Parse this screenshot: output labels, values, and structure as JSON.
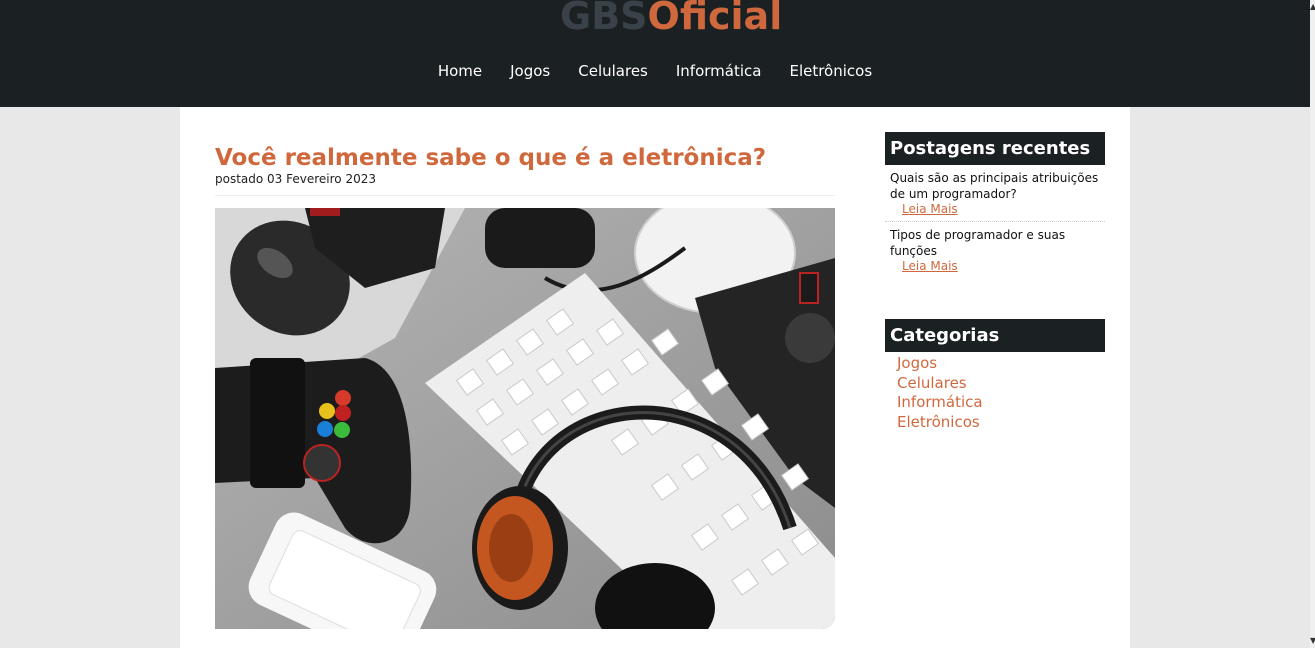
{
  "header": {
    "logo_part1": "GBS",
    "logo_part2": "Oficial",
    "nav": [
      "Home",
      "Jogos",
      "Celulares",
      "Informática",
      "Eletrônicos"
    ]
  },
  "post": {
    "title": "Você realmente sabe o que é a eletrônica?",
    "date": "postado 03 Fevereiro 2023"
  },
  "sidebar": {
    "recent_title": "Postagens recentes",
    "recent": [
      {
        "title": "Quais são as principais atribuições de um programador?",
        "more": "Leia Mais"
      },
      {
        "title": "Tipos de programador e suas funções",
        "more": "Leia Mais"
      }
    ],
    "categories_title": "Categorias",
    "categories": [
      "Jogos",
      "Celulares",
      "Informática",
      "Eletrônicos"
    ]
  },
  "colors": {
    "accent": "#d0683e",
    "header_bg": "#1b2023",
    "page_bg": "#e8e8e8"
  }
}
